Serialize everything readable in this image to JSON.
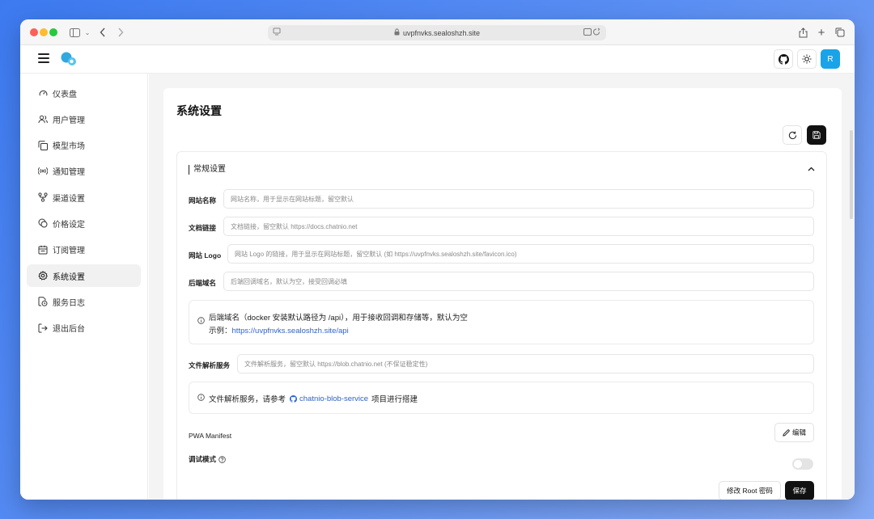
{
  "browser": {
    "url": "uvpfnvks.sealoshzh.site"
  },
  "header": {
    "avatar_letter": "R"
  },
  "sidebar": {
    "items": [
      {
        "label": "仪表盘",
        "icon": "gauge-icon"
      },
      {
        "label": "用户管理",
        "icon": "users-icon"
      },
      {
        "label": "模型市场",
        "icon": "copy-icon"
      },
      {
        "label": "通知管理",
        "icon": "radio-icon"
      },
      {
        "label": "渠道设置",
        "icon": "share-icon"
      },
      {
        "label": "价格设定",
        "icon": "coins-icon"
      },
      {
        "label": "订阅管理",
        "icon": "calendar-icon"
      },
      {
        "label": "系统设置",
        "icon": "settings-icon",
        "active": true
      },
      {
        "label": "服务日志",
        "icon": "file-clock-icon"
      },
      {
        "label": "退出后台",
        "icon": "logout-icon"
      }
    ]
  },
  "main": {
    "title": "系统设置",
    "section_title": "常规设置",
    "fields": {
      "site_name": {
        "label": "网站名称",
        "placeholder": "网站名称，用于显示在网站标题，留空默认"
      },
      "docs_link": {
        "label": "文档链接",
        "placeholder": "文档链接，留空默认 https://docs.chatnio.net"
      },
      "site_logo": {
        "label": "网站 Logo",
        "placeholder": "网站 Logo 的链接，用于显示在网站标题，留空默认 (如 https://uvpfnvks.sealoshzh.site/favicon.ico)"
      },
      "backend_domain": {
        "label": "后端域名",
        "placeholder": "后端回调域名，默认为空，接受回调必填"
      },
      "file_service": {
        "label": "文件解析服务",
        "placeholder": "文件解析服务，留空默认 https://blob.chatnio.net (不保证稳定性)"
      }
    },
    "backend_notice": {
      "line1": "后端域名（docker 安装默认路径为 /api），用于接收回调和存储等，默认为空",
      "line2_prefix": "示例：",
      "line2_link": "https://uvpfnvks.sealoshzh.site/api"
    },
    "file_notice": {
      "prefix": "文件解析服务，请参考",
      "link": "chatnio-blob-service",
      "suffix": "项目进行搭建"
    },
    "pwa": {
      "label": "PWA Manifest",
      "edit_label": "编辑"
    },
    "debug": {
      "label": "调试模式",
      "enabled": false
    },
    "buttons": {
      "change_root": "修改 Root 密码",
      "save": "保存"
    }
  }
}
